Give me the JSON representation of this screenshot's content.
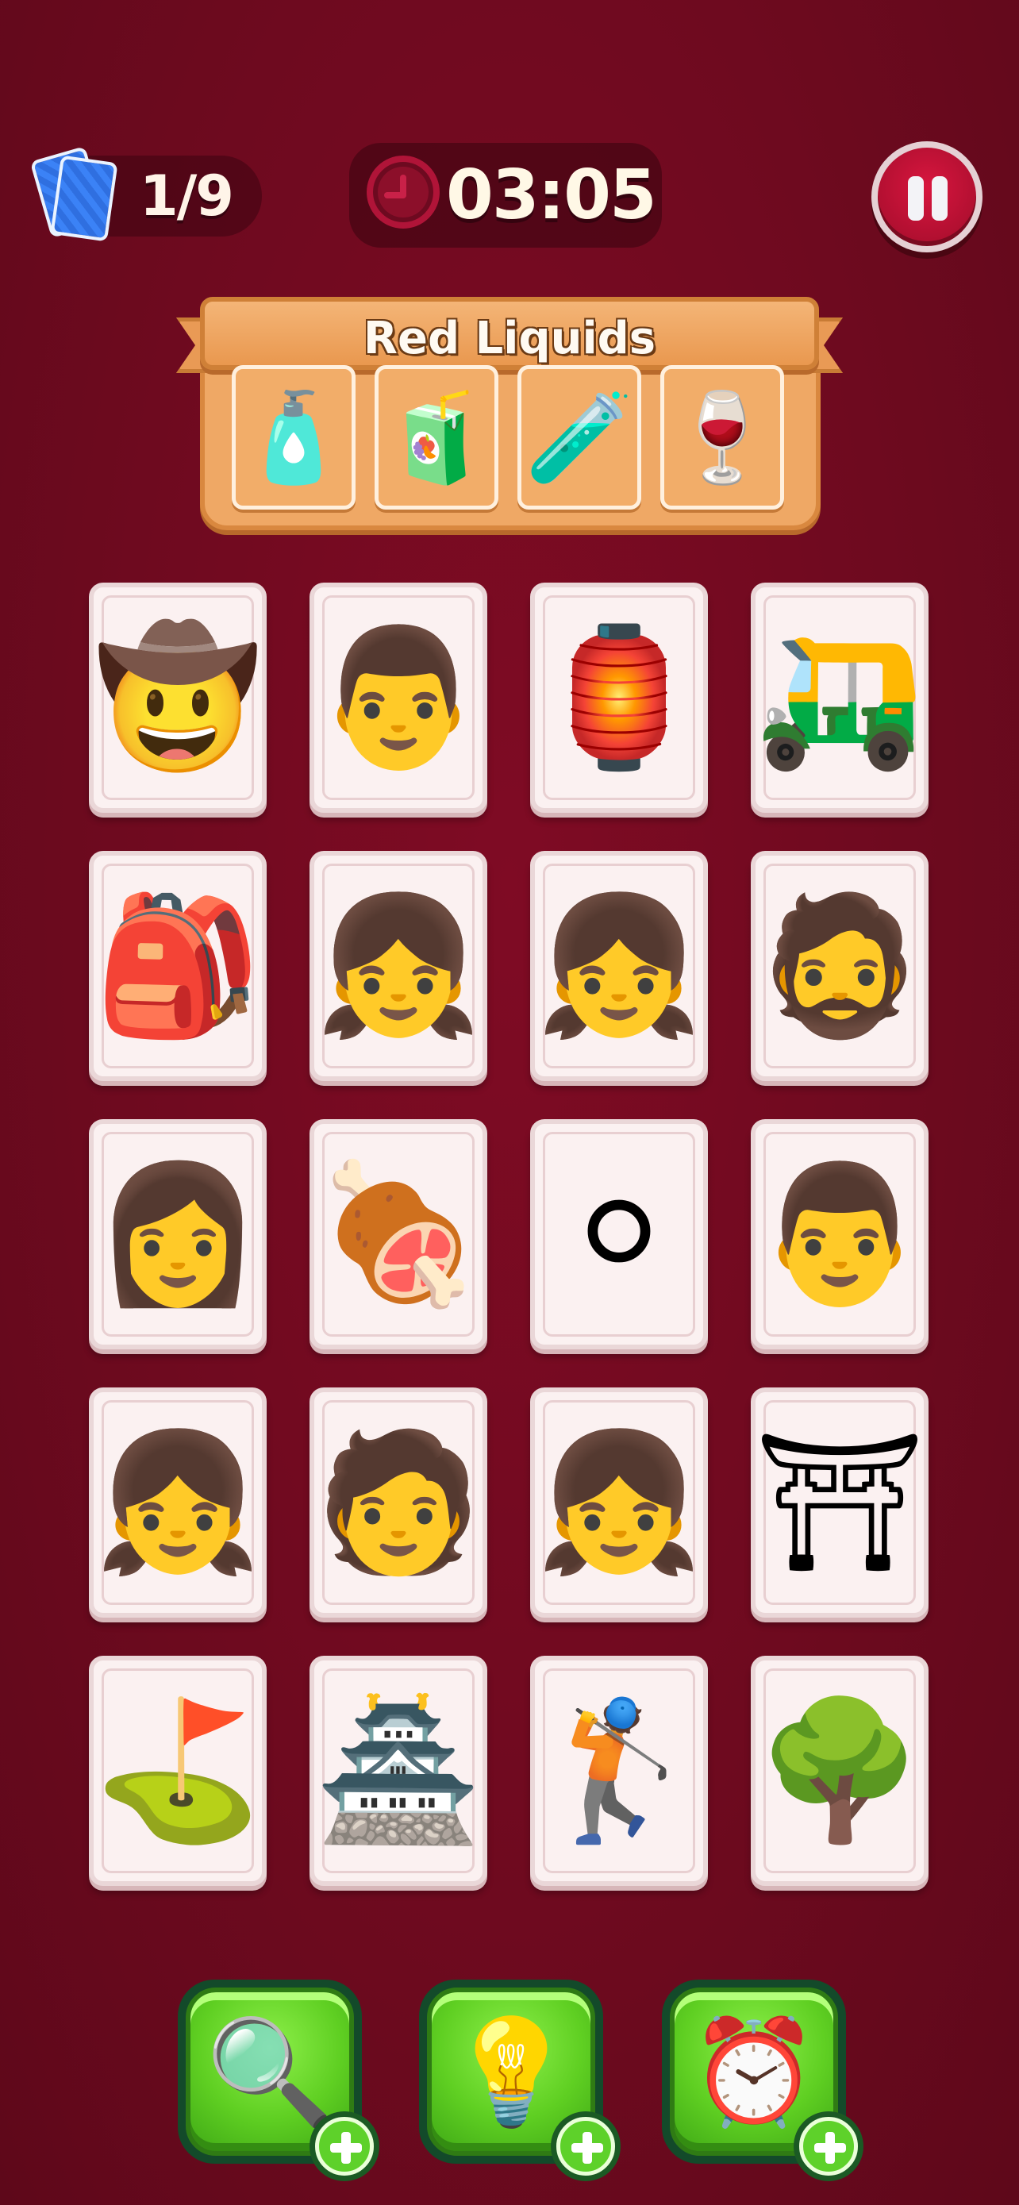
{
  "header": {
    "deck_count": "1/9",
    "timer": "03:05",
    "deck_icon": "cards-icon",
    "clock_icon": "clock-icon",
    "pause_icon": "pause-icon"
  },
  "category": {
    "title": "Red Liquids",
    "slots": [
      {
        "name": "medicine-bottle",
        "glyph": "🧴"
      },
      {
        "name": "apple-juice-bottle",
        "glyph": "🧃"
      },
      {
        "name": "perfume-bottle",
        "glyph": "🧪"
      },
      {
        "name": "red-wine-glass",
        "glyph": "🍷"
      }
    ]
  },
  "grid": [
    [
      {
        "name": "cowboy-hat",
        "glyph": "🤠"
      },
      {
        "name": "cowboy-man-glasses",
        "glyph": "👨"
      },
      {
        "name": "stone-lantern",
        "glyph": "🏮"
      },
      {
        "name": "golf-cart",
        "glyph": "🛺"
      }
    ],
    [
      {
        "name": "golf-bag",
        "glyph": "🎒"
      },
      {
        "name": "bunny-girl-red-hair",
        "glyph": "👧"
      },
      {
        "name": "bunny-girl-dark",
        "glyph": "👧"
      },
      {
        "name": "cowboy-bearded-man",
        "glyph": "🧔"
      }
    ],
    [
      {
        "name": "golfer-woman",
        "glyph": "👩"
      },
      {
        "name": "barbecue-grill",
        "glyph": "🍖"
      },
      {
        "name": "golf-ball",
        "glyph": "⚪"
      },
      {
        "name": "cowboy-man-dark",
        "glyph": "👨"
      }
    ],
    [
      {
        "name": "bunny-girl-black-hair",
        "glyph": "👧"
      },
      {
        "name": "cowboy-long-hair",
        "glyph": "🧑"
      },
      {
        "name": "bunny-girl-blonde",
        "glyph": "👧"
      },
      {
        "name": "torii-gate",
        "glyph": "⛩"
      }
    ],
    [
      {
        "name": "putting-green",
        "glyph": "⛳"
      },
      {
        "name": "japanese-pagoda",
        "glyph": "🏯"
      },
      {
        "name": "golfer-woman-cap",
        "glyph": "🏌"
      },
      {
        "name": "bonsai-tree",
        "glyph": "🌳"
      }
    ]
  ],
  "boosters": [
    {
      "name": "magnifier",
      "glyph": "🔍"
    },
    {
      "name": "lightbulb",
      "glyph": "💡"
    },
    {
      "name": "alarm-clock",
      "glyph": "⏰"
    }
  ],
  "colors": {
    "background": "#6e0a1f",
    "panel": "#efa865",
    "card": "#fbf1f1",
    "booster": "#5fcf22"
  }
}
